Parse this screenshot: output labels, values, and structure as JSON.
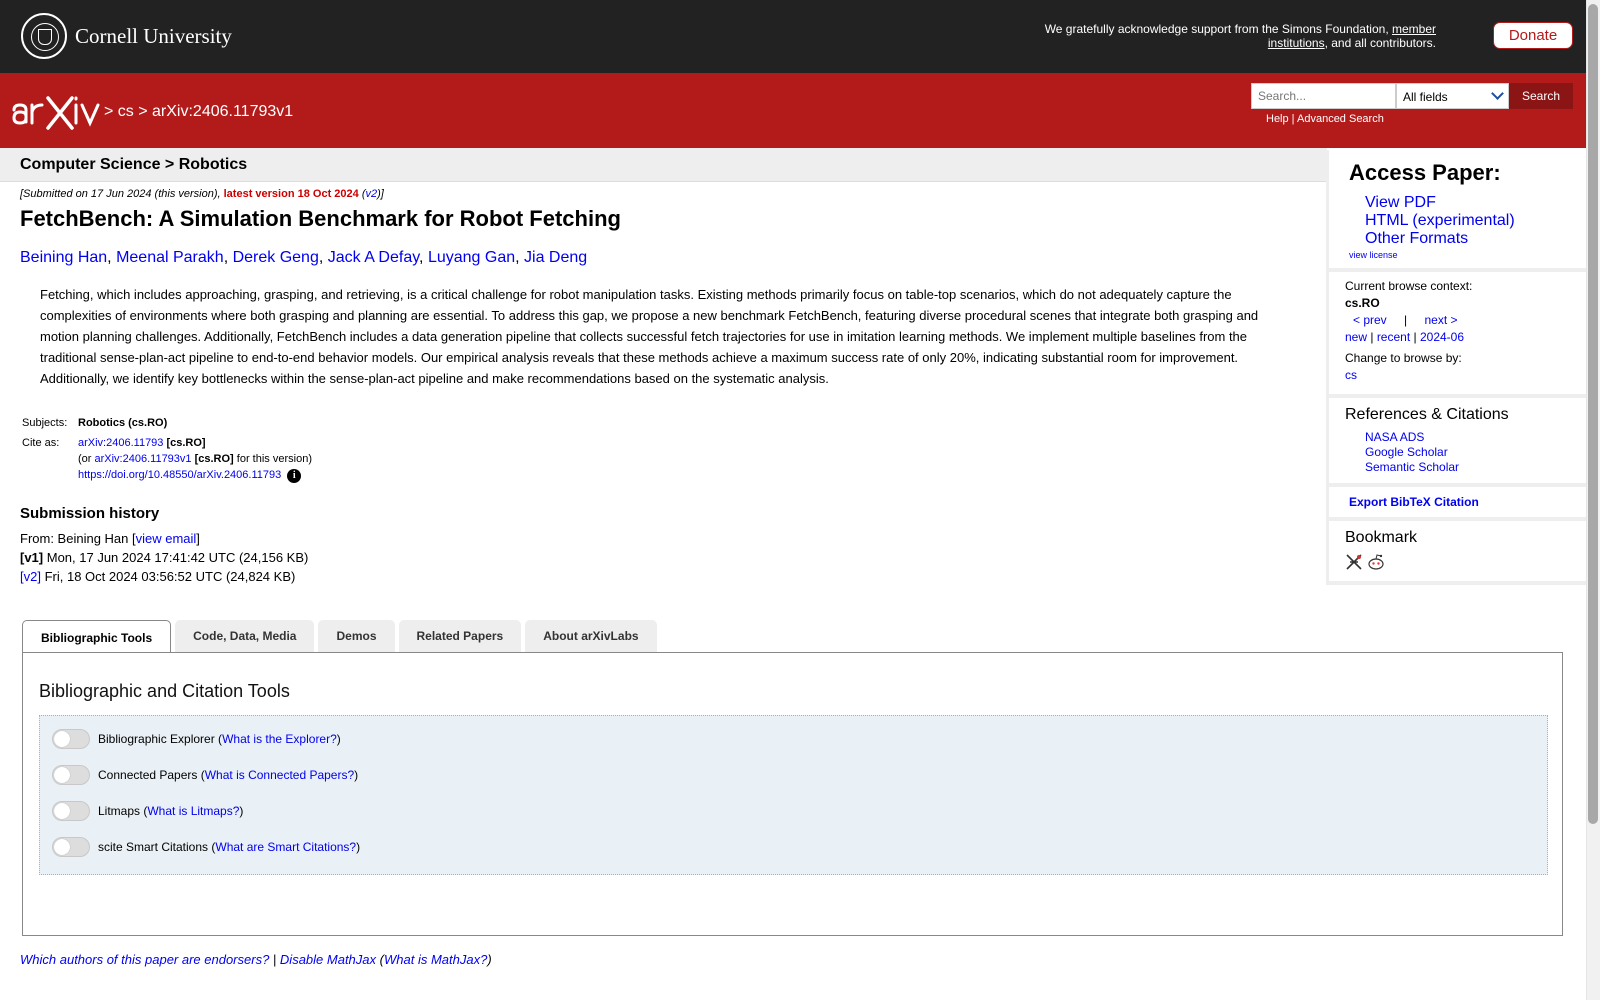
{
  "top_banner": {
    "institution": "Cornell University",
    "support_text": "We gratefully acknowledge support from the Simons Foundation, ",
    "support_link": "member institutions",
    "support_tail": ", and all contributors.",
    "donate_label": "Donate"
  },
  "header": {
    "logo_name": "arxiv-logo",
    "crumb_sep1": " > ",
    "crumb_cs": "cs",
    "crumb_sep2": " > ",
    "crumb_id": "arXiv:2406.11793v1",
    "search_placeholder": "Search...",
    "search_field": "All fields",
    "search_button": "Search",
    "help": "Help",
    "pipe": " | ",
    "advanced": "Advanced Search"
  },
  "subheader": {
    "text": "Computer Science > Robotics"
  },
  "paper": {
    "submitted": "[Submitted on 17 Jun 2024 (this version), ",
    "latest": "latest version 18 Oct 2024",
    "v2_open": " (",
    "v2": "v2",
    "v2_close": ")]",
    "title": "FetchBench: A Simulation Benchmark for Robot Fetching",
    "authors": [
      "Beining Han",
      "Meenal Parakh",
      "Derek Geng",
      "Jack A Defay",
      "Luyang Gan",
      "Jia Deng"
    ],
    "abstract": "Fetching, which includes approaching, grasping, and retrieving, is a critical challenge for robot manipulation tasks. Existing methods primarily focus on table-top scenarios, which do not adequately capture the complexities of environments where both grasping and planning are essential. To address this gap, we propose a new benchmark FetchBench, featuring diverse procedural scenes that integrate both grasping and motion planning challenges. Additionally, FetchBench includes a data generation pipeline that collects successful fetch trajectories for use in imitation learning methods. We implement multiple baselines from the traditional sense-plan-act pipeline to end-to-end behavior models. Our empirical analysis reveals that these methods achieve a maximum success rate of only 20%, indicating substantial room for improvement. Additionally, we identify key bottlenecks within the sense-plan-act pipeline and make recommendations based on the systematic analysis."
  },
  "meta": {
    "subjects_label": "Subjects:",
    "subjects_value": "Robotics (cs.RO)",
    "cite_label": "Cite as:",
    "cite_id": "arXiv:2406.11793",
    "cite_cat": " [cs.RO]",
    "cite_or": "(or ",
    "cite_v1": "arXiv:2406.11793v1",
    "cite_cat2": " [cs.RO]",
    "cite_tail": " for this version)",
    "doi": "https://doi.org/10.48550/arXiv.2406.11793",
    "info_glyph": "i"
  },
  "history": {
    "heading": "Submission history",
    "from": "From: Beining Han [",
    "view_email": "view email",
    "from_close": "]",
    "v1_label": "[v1]",
    "v1_text": " Mon, 17 Jun 2024 17:41:42 UTC (24,156 KB)",
    "v2_label": "[v2]",
    "v2_text": " Fri, 18 Oct 2024 03:56:52 UTC (24,824 KB)"
  },
  "tabs": [
    "Bibliographic Tools",
    "Code, Data, Media",
    "Demos",
    "Related Papers",
    "About arXivLabs"
  ],
  "tools": {
    "heading": "Bibliographic and Citation Tools",
    "items": [
      {
        "label": "Bibliographic Explorer (",
        "link": "What is the Explorer?",
        "close": ")"
      },
      {
        "label": "Connected Papers (",
        "link": "What is Connected Papers?",
        "close": ")"
      },
      {
        "label": "Litmaps (",
        "link": "What is Litmaps?",
        "close": ")"
      },
      {
        "label": "scite Smart Citations (",
        "link": "What are Smart Citations?",
        "close": ")"
      }
    ]
  },
  "footer": {
    "endorsers": "Which authors of this paper are endorsers?",
    "sep": " | ",
    "mathjax": "Disable MathJax",
    "open": " (",
    "what_mathjax": "What is MathJax?",
    "close": ")"
  },
  "sidebar": {
    "access_heading": "Access Paper:",
    "access_links": [
      "View PDF",
      "HTML (experimental)",
      "Other Formats"
    ],
    "view_license": "view license",
    "browse_label": "Current browse context:",
    "browse_context": "cs.RO",
    "prev": "< prev",
    "bar": "|",
    "next": "next >",
    "new": "new",
    "recent": "recent",
    "date": "2024-06",
    "change_label": "Change to browse by:",
    "change_cs": "cs",
    "refs_heading": "References & Citations",
    "refs": [
      "NASA ADS",
      "Google Scholar",
      "Semantic Scholar"
    ],
    "bibtex": "Export BibTeX Citation",
    "bookmark_heading": "Bookmark",
    "bookmark_icons": [
      "bibsonomy-icon",
      "reddit-icon"
    ]
  },
  "colors": {
    "brand_red": "#b31b1b",
    "dark_banner": "#222222",
    "link_blue": "#0000ee",
    "latest_red": "#cc0000"
  }
}
